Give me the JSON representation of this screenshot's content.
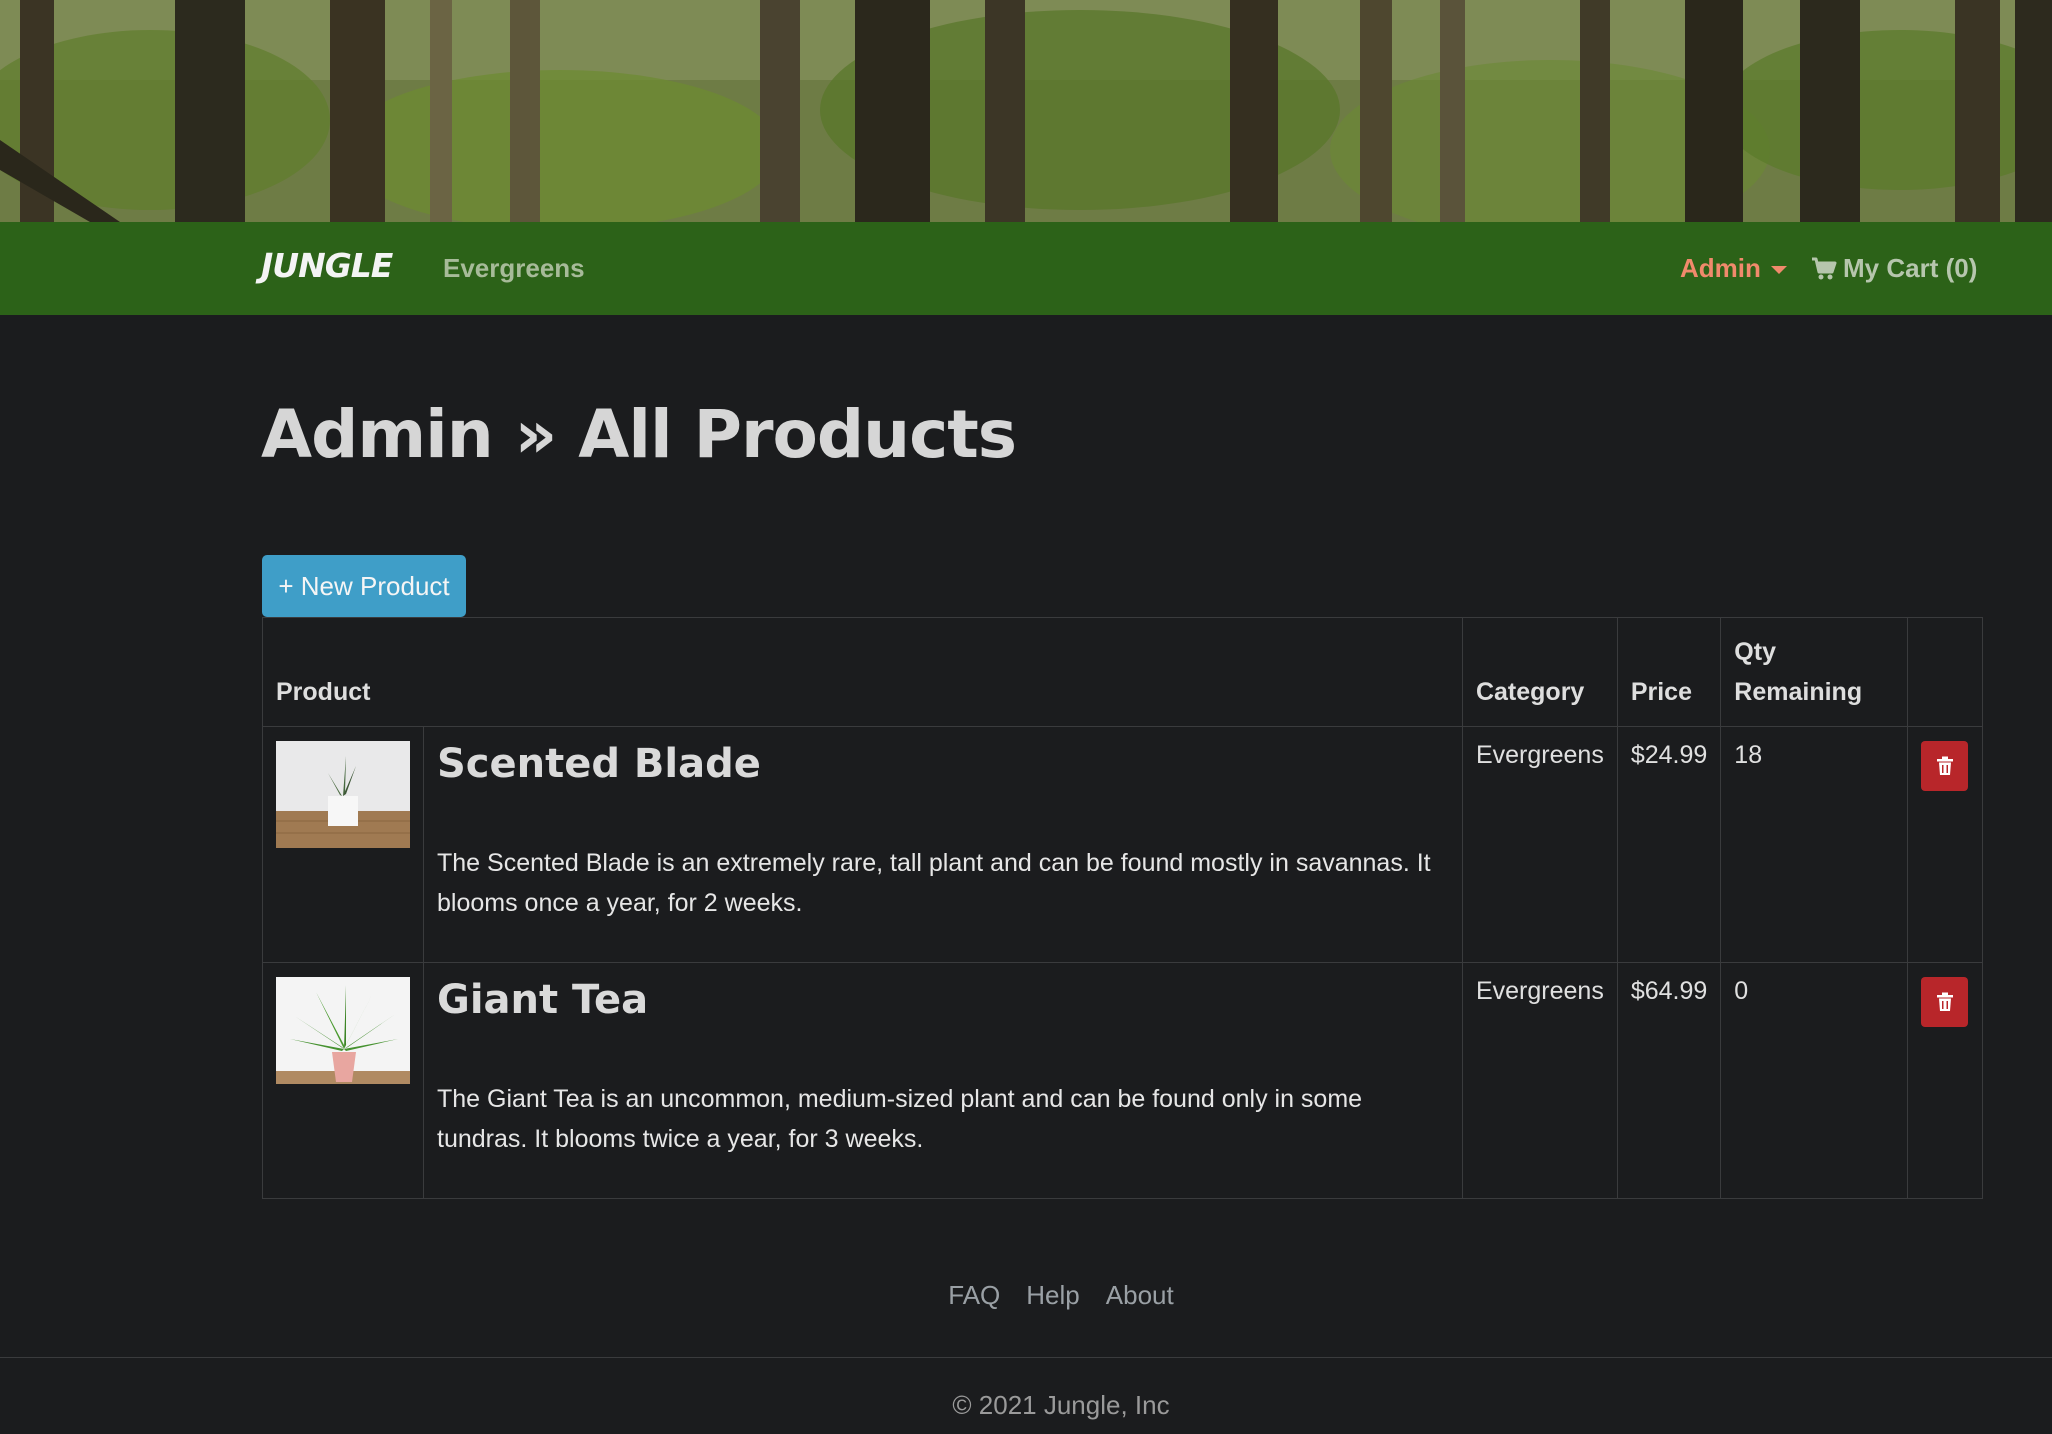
{
  "navbar": {
    "brand": "JUNGLE",
    "category_link": "Evergreens",
    "admin_label": "Admin",
    "cart_label": "My Cart (0)"
  },
  "page": {
    "title": "Admin » All Products",
    "new_product_button": "+ New Product"
  },
  "table": {
    "headers": {
      "product": "Product",
      "category": "Category",
      "price": "Price",
      "qty": "Qty Remaining"
    },
    "rows": [
      {
        "name": "Scented Blade",
        "description": "The Scented Blade is an extremely rare, tall plant and can be found mostly in savannas. It blooms once a year, for 2 weeks.",
        "category": "Evergreens",
        "price": "$24.99",
        "qty": "18"
      },
      {
        "name": "Giant Tea",
        "description": "The Giant Tea is an uncommon, medium-sized plant and can be found only in some tundras. It blooms twice a year, for 3 weeks.",
        "category": "Evergreens",
        "price": "$64.99",
        "qty": "0"
      }
    ]
  },
  "footer": {
    "links": [
      "FAQ",
      "Help",
      "About"
    ],
    "copyright": "© 2021 Jungle, Inc"
  },
  "colors": {
    "navbar": "#2c6218",
    "accent_button": "#3f9ec8",
    "delete_button": "#b8262a",
    "admin_link": "#f08a6c",
    "background": "#1b1c1e"
  },
  "icons": {
    "cart": "cart-icon",
    "delete": "trash-icon",
    "dropdown": "chevron-down-icon"
  }
}
